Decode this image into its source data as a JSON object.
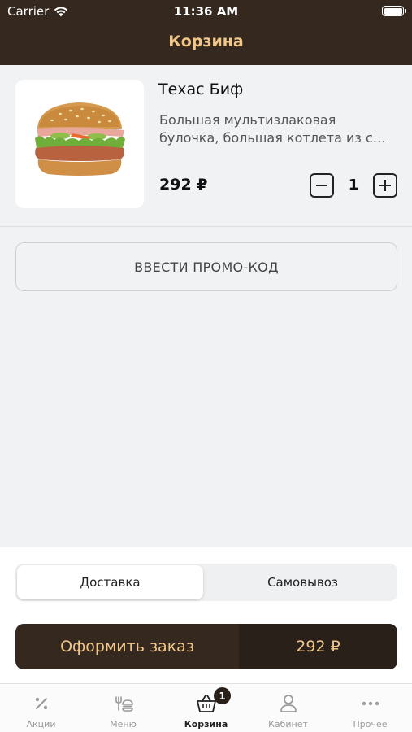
{
  "status_bar": {
    "carrier": "Carrier",
    "time": "11:36 AM"
  },
  "header": {
    "title": "Корзина"
  },
  "cart_item": {
    "name": "Техас Биф",
    "description": "Большая мультизлаковая булочка, большая котлета из с…",
    "price": "292 ₽",
    "quantity": "1"
  },
  "promo": {
    "label": "ВВЕСТИ ПРОМО-КОД"
  },
  "delivery": {
    "options": [
      {
        "label": "Доставка",
        "selected": true
      },
      {
        "label": "Самовывоз",
        "selected": false
      }
    ]
  },
  "checkout": {
    "label": "Оформить заказ",
    "total": "292 ₽"
  },
  "tabs": [
    {
      "label": "Акции",
      "icon": "percent-icon"
    },
    {
      "label": "Меню",
      "icon": "menu-food-icon"
    },
    {
      "label": "Корзина",
      "icon": "basket-icon",
      "badge": "1",
      "active": true
    },
    {
      "label": "Кабинет",
      "icon": "user-icon"
    },
    {
      "label": "Прочее",
      "icon": "more-dots-icon"
    }
  ],
  "colors": {
    "header_bg": "#34281f",
    "accent": "#f1c88a",
    "checkout_sum_bg": "#2a201a"
  }
}
